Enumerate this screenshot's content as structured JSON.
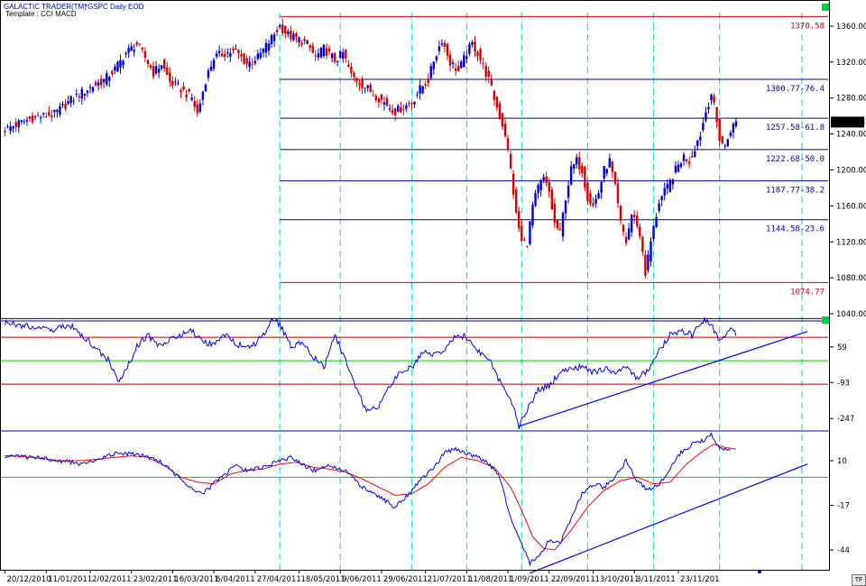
{
  "header": {
    "app_name": "GALACTIC TRADER(TM)",
    "symbol": "*GSPC Daily EOD",
    "template": "Template : CCI MACD"
  },
  "colors": {
    "up": "#0000dd",
    "down": "#dd0000",
    "indicator": "#0000ff",
    "signal": "#ff0000",
    "fib": "#0000aa",
    "fib_extreme": "#cc0000",
    "cycle": "#22dddd",
    "level_red": "#bb0000",
    "level_green": "#00cc00",
    "marker": "#00cc44"
  },
  "corner_button": "TF",
  "chart_data": [
    {
      "type": "candlestick",
      "name": "price",
      "x_start": "20/12/2010",
      "y_ticks": [
        1040,
        1080,
        1120,
        1160,
        1200,
        1240,
        1280,
        1320,
        1360
      ],
      "ylim": [
        1032,
        1375
      ],
      "last_price": "1253.23",
      "close_path": [
        [
          0,
          1245
        ],
        [
          10,
          1258
        ],
        [
          18,
          1262
        ],
        [
          24,
          1278
        ],
        [
          30,
          1290
        ],
        [
          36,
          1300
        ],
        [
          40,
          1312
        ],
        [
          44,
          1330
        ],
        [
          48,
          1340
        ],
        [
          51,
          1325
        ],
        [
          54,
          1308
        ],
        [
          57,
          1318
        ],
        [
          60,
          1298
        ],
        [
          64,
          1290
        ],
        [
          68,
          1280
        ],
        [
          70,
          1262
        ],
        [
          73,
          1300
        ],
        [
          76,
          1325
        ],
        [
          80,
          1330
        ],
        [
          84,
          1332
        ],
        [
          88,
          1318
        ],
        [
          92,
          1325
        ],
        [
          96,
          1342
        ],
        [
          100,
          1360
        ],
        [
          103,
          1350
        ],
        [
          107,
          1345
        ],
        [
          110,
          1340
        ],
        [
          113,
          1325
        ],
        [
          116,
          1335
        ],
        [
          120,
          1322
        ],
        [
          123,
          1330
        ],
        [
          126,
          1305
        ],
        [
          130,
          1295
        ],
        [
          134,
          1285
        ],
        [
          138,
          1275
        ],
        [
          142,
          1265
        ],
        [
          145,
          1270
        ],
        [
          148,
          1275
        ],
        [
          151,
          1290
        ],
        [
          154,
          1300
        ],
        [
          156,
          1322
        ],
        [
          159,
          1345
        ],
        [
          162,
          1320
        ],
        [
          165,
          1310
        ],
        [
          168,
          1330
        ],
        [
          170,
          1340
        ],
        [
          172,
          1330
        ],
        [
          174,
          1315
        ],
        [
          176,
          1300
        ],
        [
          178,
          1280
        ],
        [
          180,
          1260
        ],
        [
          182,
          1240
        ],
        [
          184,
          1200
        ],
        [
          186,
          1150
        ],
        [
          188,
          1120
        ],
        [
          190,
          1120
        ],
        [
          192,
          1160
        ],
        [
          194,
          1180
        ],
        [
          196,
          1190
        ],
        [
          198,
          1175
        ],
        [
          200,
          1140
        ],
        [
          202,
          1130
        ],
        [
          204,
          1170
        ],
        [
          206,
          1200
        ],
        [
          208,
          1210
        ],
        [
          210,
          1200
        ],
        [
          212,
          1170
        ],
        [
          214,
          1160
        ],
        [
          216,
          1175
        ],
        [
          218,
          1200
        ],
        [
          220,
          1210
        ],
        [
          222,
          1180
        ],
        [
          224,
          1140
        ],
        [
          226,
          1120
        ],
        [
          228,
          1150
        ],
        [
          230,
          1140
        ],
        [
          232,
          1110
        ],
        [
          233,
          1085
        ],
        [
          235,
          1120
        ],
        [
          238,
          1165
        ],
        [
          241,
          1180
        ],
        [
          244,
          1200
        ],
        [
          247,
          1215
        ],
        [
          249,
          1210
        ],
        [
          251,
          1225
        ],
        [
          253,
          1240
        ],
        [
          255,
          1265
        ],
        [
          257,
          1285
        ],
        [
          258,
          1270
        ],
        [
          260,
          1235
        ],
        [
          262,
          1225
        ],
        [
          264,
          1245
        ],
        [
          266,
          1253
        ]
      ],
      "fib_levels": [
        {
          "value": 1370.58,
          "label": "1370.58",
          "extreme": true
        },
        {
          "value": 1300.77,
          "label": "1300.77-76.4",
          "extreme": false
        },
        {
          "value": 1257.58,
          "label": "1257.58-61.8",
          "extreme": false
        },
        {
          "value": 1222.68,
          "label": "1222.68-50.0",
          "extreme": false
        },
        {
          "value": 1187.77,
          "label": "1187.77-38.2",
          "extreme": false
        },
        {
          "value": 1144.58,
          "label": "1144.58-23.6",
          "extreme": false
        },
        {
          "value": 1074.77,
          "label": "1074.77",
          "extreme": true
        }
      ],
      "fib_start_bar": 100,
      "cycle_bars": [
        100,
        122,
        148,
        168,
        188,
        212,
        236,
        260,
        290
      ]
    },
    {
      "type": "line",
      "name": "CCI",
      "y_ticks": [
        59,
        -93,
        -247
      ],
      "ylim": [
        -300,
        170
      ],
      "levels_red": [
        100,
        -100
      ],
      "level_green": 0,
      "reference_line": 180,
      "values_path": [
        [
          0,
          160
        ],
        [
          8,
          150
        ],
        [
          16,
          130
        ],
        [
          20,
          140
        ],
        [
          24,
          150
        ],
        [
          30,
          90
        ],
        [
          34,
          40
        ],
        [
          38,
          0
        ],
        [
          41,
          -90
        ],
        [
          44,
          -40
        ],
        [
          48,
          60
        ],
        [
          52,
          110
        ],
        [
          56,
          60
        ],
        [
          60,
          90
        ],
        [
          64,
          110
        ],
        [
          68,
          130
        ],
        [
          72,
          80
        ],
        [
          76,
          70
        ],
        [
          80,
          110
        ],
        [
          84,
          70
        ],
        [
          90,
          60
        ],
        [
          94,
          110
        ],
        [
          97,
          170
        ],
        [
          100,
          160
        ],
        [
          104,
          60
        ],
        [
          108,
          80
        ],
        [
          112,
          20
        ],
        [
          116,
          -30
        ],
        [
          120,
          110
        ],
        [
          124,
          0
        ],
        [
          128,
          -130
        ],
        [
          132,
          -220
        ],
        [
          136,
          -190
        ],
        [
          140,
          -110
        ],
        [
          144,
          -50
        ],
        [
          148,
          -30
        ],
        [
          152,
          40
        ],
        [
          156,
          30
        ],
        [
          160,
          50
        ],
        [
          164,
          110
        ],
        [
          168,
          100
        ],
        [
          172,
          40
        ],
        [
          176,
          10
        ],
        [
          180,
          -90
        ],
        [
          184,
          -160
        ],
        [
          187,
          -280
        ],
        [
          190,
          -210
        ],
        [
          194,
          -120
        ],
        [
          198,
          -110
        ],
        [
          202,
          -50
        ],
        [
          206,
          -40
        ],
        [
          210,
          -20
        ],
        [
          214,
          -50
        ],
        [
          218,
          -30
        ],
        [
          222,
          -60
        ],
        [
          226,
          -20
        ],
        [
          230,
          -80
        ],
        [
          234,
          -40
        ],
        [
          238,
          40
        ],
        [
          242,
          110
        ],
        [
          246,
          130
        ],
        [
          250,
          110
        ],
        [
          254,
          170
        ],
        [
          257,
          160
        ],
        [
          260,
          80
        ],
        [
          264,
          140
        ],
        [
          266,
          120
        ]
      ],
      "trendline": [
        [
          187,
          -280
        ],
        [
          292,
          125
        ]
      ]
    },
    {
      "type": "line",
      "name": "MACD",
      "y_ticks": [
        10,
        -17,
        -44
      ],
      "ylim": [
        -56,
        28
      ],
      "level_green": 0,
      "reference_line": 28,
      "macd_path": [
        [
          0,
          13
        ],
        [
          10,
          12
        ],
        [
          20,
          10
        ],
        [
          28,
          8
        ],
        [
          34,
          11
        ],
        [
          40,
          14
        ],
        [
          46,
          14
        ],
        [
          50,
          13
        ],
        [
          56,
          10
        ],
        [
          62,
          2
        ],
        [
          66,
          -5
        ],
        [
          72,
          -10
        ],
        [
          78,
          -1
        ],
        [
          84,
          7
        ],
        [
          88,
          4
        ],
        [
          94,
          6
        ],
        [
          100,
          10
        ],
        [
          104,
          12
        ],
        [
          108,
          8
        ],
        [
          112,
          4
        ],
        [
          118,
          7
        ],
        [
          124,
          4
        ],
        [
          130,
          -6
        ],
        [
          136,
          -12
        ],
        [
          142,
          -18
        ],
        [
          148,
          -8
        ],
        [
          152,
          0
        ],
        [
          156,
          5
        ],
        [
          160,
          15
        ],
        [
          164,
          17
        ],
        [
          168,
          14
        ],
        [
          172,
          12
        ],
        [
          176,
          8
        ],
        [
          180,
          0
        ],
        [
          184,
          -25
        ],
        [
          188,
          -40
        ],
        [
          191,
          -52
        ],
        [
          194,
          -48
        ],
        [
          198,
          -38
        ],
        [
          202,
          -40
        ],
        [
          206,
          -25
        ],
        [
          210,
          -10
        ],
        [
          214,
          -4
        ],
        [
          218,
          -6
        ],
        [
          222,
          0
        ],
        [
          226,
          10
        ],
        [
          230,
          -2
        ],
        [
          234,
          -8
        ],
        [
          238,
          -4
        ],
        [
          242,
          5
        ],
        [
          246,
          15
        ],
        [
          250,
          20
        ],
        [
          254,
          22
        ],
        [
          257,
          26
        ],
        [
          260,
          18
        ],
        [
          264,
          16
        ]
      ],
      "signal_path": [
        [
          0,
          13
        ],
        [
          10,
          12
        ],
        [
          20,
          10
        ],
        [
          28,
          10
        ],
        [
          34,
          11
        ],
        [
          40,
          12
        ],
        [
          46,
          13
        ],
        [
          52,
          12
        ],
        [
          58,
          7
        ],
        [
          64,
          0
        ],
        [
          70,
          -3
        ],
        [
          76,
          -4
        ],
        [
          82,
          2
        ],
        [
          88,
          4
        ],
        [
          94,
          5
        ],
        [
          100,
          8
        ],
        [
          106,
          9
        ],
        [
          112,
          6
        ],
        [
          118,
          5
        ],
        [
          124,
          3
        ],
        [
          130,
          -1
        ],
        [
          136,
          -6
        ],
        [
          142,
          -11
        ],
        [
          148,
          -10
        ],
        [
          154,
          -4
        ],
        [
          160,
          6
        ],
        [
          166,
          12
        ],
        [
          172,
          10
        ],
        [
          178,
          6
        ],
        [
          184,
          -6
        ],
        [
          188,
          -20
        ],
        [
          192,
          -36
        ],
        [
          196,
          -43
        ],
        [
          200,
          -44
        ],
        [
          206,
          -32
        ],
        [
          212,
          -18
        ],
        [
          218,
          -8
        ],
        [
          224,
          -2
        ],
        [
          230,
          0
        ],
        [
          236,
          -4
        ],
        [
          242,
          -3
        ],
        [
          248,
          8
        ],
        [
          254,
          16
        ],
        [
          258,
          20
        ],
        [
          262,
          18
        ],
        [
          266,
          17
        ]
      ],
      "trendline": [
        [
          191,
          -58
        ],
        [
          292,
          8
        ]
      ]
    }
  ],
  "x_axis_labels": [
    {
      "bar": 0,
      "label": "20/12/2010"
    },
    {
      "bar": 15,
      "label": "11/01/2011"
    },
    {
      "bar": 31,
      "label": "2/02/2011"
    },
    {
      "bar": 46,
      "label": "23/02/2011"
    },
    {
      "bar": 61,
      "label": "16/03/2011"
    },
    {
      "bar": 76,
      "label": "6/04/2011"
    },
    {
      "bar": 91,
      "label": "27/04/2011"
    },
    {
      "bar": 107,
      "label": "18/05/2011"
    },
    {
      "bar": 122,
      "label": "9/06/2011"
    },
    {
      "bar": 137,
      "label": "29/06/2011"
    },
    {
      "bar": 153,
      "label": "21/07/2011"
    },
    {
      "bar": 168,
      "label": "11/08/2011"
    },
    {
      "bar": 183,
      "label": "1/09/2011"
    },
    {
      "bar": 198,
      "label": "22/09/2011"
    },
    {
      "bar": 214,
      "label": "13/10/2011"
    },
    {
      "bar": 229,
      "label": "3/11/2011"
    },
    {
      "bar": 245,
      "label": "23/11/201"
    }
  ]
}
